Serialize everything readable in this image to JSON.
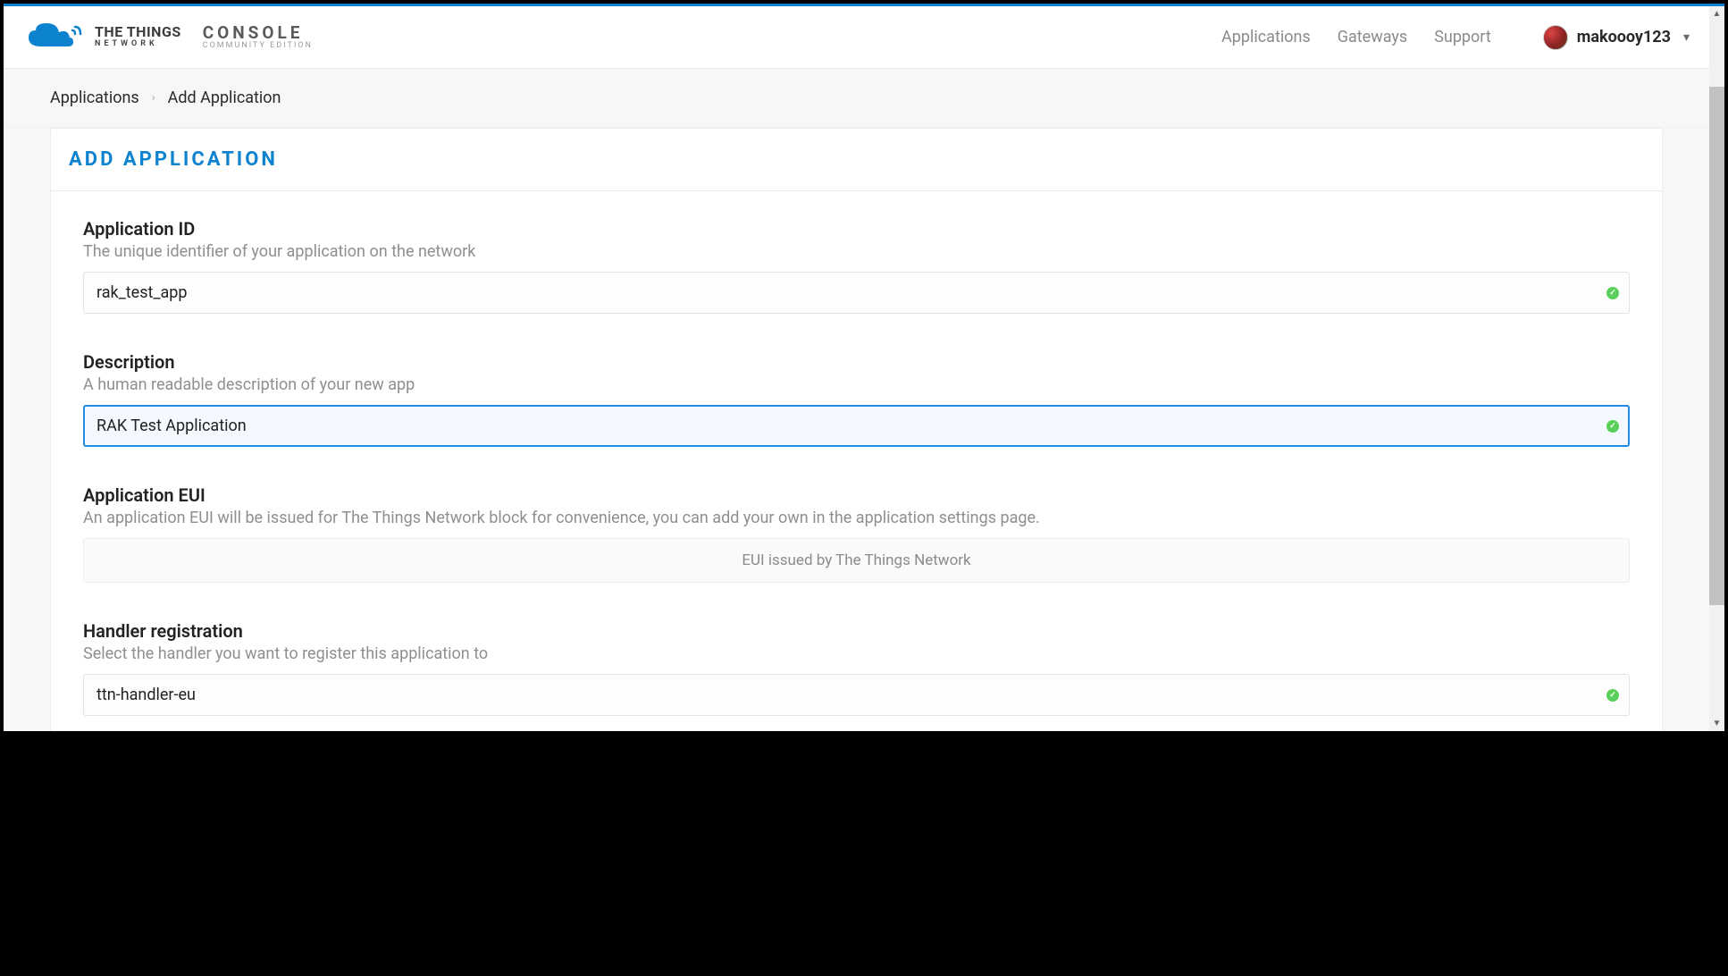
{
  "header": {
    "logo_brand": "THE THINGS",
    "logo_sub": "NETWORK",
    "console_title": "CONSOLE",
    "console_sub": "COMMUNITY EDITION",
    "nav": [
      {
        "label": "Applications"
      },
      {
        "label": "Gateways"
      },
      {
        "label": "Support"
      }
    ],
    "username": "makoooy123"
  },
  "breadcrumb": {
    "items": [
      {
        "label": "Applications"
      },
      {
        "label": "Add Application"
      }
    ]
  },
  "page": {
    "title": "ADD APPLICATION",
    "fields": {
      "app_id": {
        "label": "Application ID",
        "help": "The unique identifier of your application on the network",
        "value": "rak_test_app"
      },
      "description": {
        "label": "Description",
        "help": "A human readable description of your new app",
        "value": "RAK Test Application"
      },
      "app_eui": {
        "label": "Application EUI",
        "help": "An application EUI will be issued for The Things Network block for convenience, you can add your own in the application settings page.",
        "placeholder": "EUI issued by The Things Network"
      },
      "handler": {
        "label": "Handler registration",
        "help": "Select the handler you want to register this application to",
        "value": "ttn-handler-eu"
      }
    }
  }
}
